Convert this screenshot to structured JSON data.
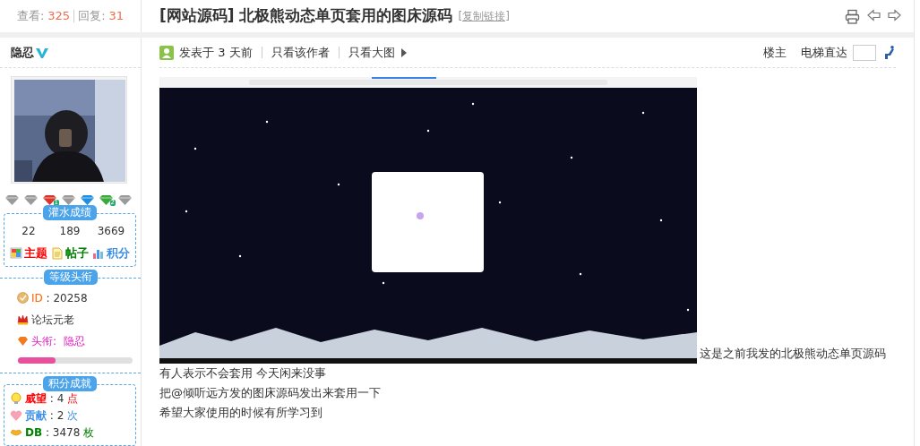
{
  "thread": {
    "views_label": "查看:",
    "views": "325",
    "replies_label": "回复:",
    "replies": "31",
    "title": "[网站源码] 北极熊动态单页套用的图床源码",
    "copy_link": "[复制链接]"
  },
  "author": {
    "name": "隐忍",
    "verified": true,
    "medals": [
      {
        "color": "#9a9a9a"
      },
      {
        "color": "#9a9a9a"
      },
      {
        "color": "#d9342b",
        "count": "1"
      },
      {
        "color": "#9a9a9a"
      },
      {
        "color": "#1e8fe0"
      },
      {
        "color": "#3aa83a",
        "count": "2"
      },
      {
        "color": "#9a9a9a"
      }
    ]
  },
  "water_stats": {
    "title": "灌水成绩",
    "items": [
      {
        "value": "22",
        "label": "主题",
        "color": "#ff0000",
        "kind": "grid"
      },
      {
        "value": "189",
        "label": "帖子",
        "color": "#008000",
        "kind": "doc"
      },
      {
        "value": "3669",
        "label": "积分",
        "color": "#3a8ee6",
        "kind": "chart"
      }
    ]
  },
  "rank": {
    "title": "等级头衔",
    "id_label": "ID",
    "id": ": 20258",
    "group": "论坛元老",
    "rank_label": "头衔:",
    "rank": "隐忍",
    "level": 0.33
  },
  "points": {
    "title": "积分成就",
    "items": [
      {
        "label": "威望",
        "value": ": 4",
        "unit": "点",
        "color": "#ff0000",
        "kind": "bulb"
      },
      {
        "label": "贡献",
        "value": ": 2",
        "unit": "次",
        "color": "#3a8ee6",
        "kind": "heart"
      },
      {
        "label": "DB",
        "value": ": 3478",
        "unit": "枚",
        "color": "#008000",
        "kind": "ingot"
      }
    ]
  },
  "post": {
    "posted": "发表于 3 天前",
    "links": [
      "只看该作者",
      "只看大图"
    ],
    "floor": "楼主",
    "jump_label": "电梯直达",
    "image": {
      "kind": "picture"
    },
    "paragraphs": [
      "这是之前我发的北极熊动态单页源码",
      "有人表示不会套用  今天闲来没事",
      "把@倾听远方发的图床源码发出来套用一下",
      "希望大家使用的时候有所学习到"
    ]
  }
}
